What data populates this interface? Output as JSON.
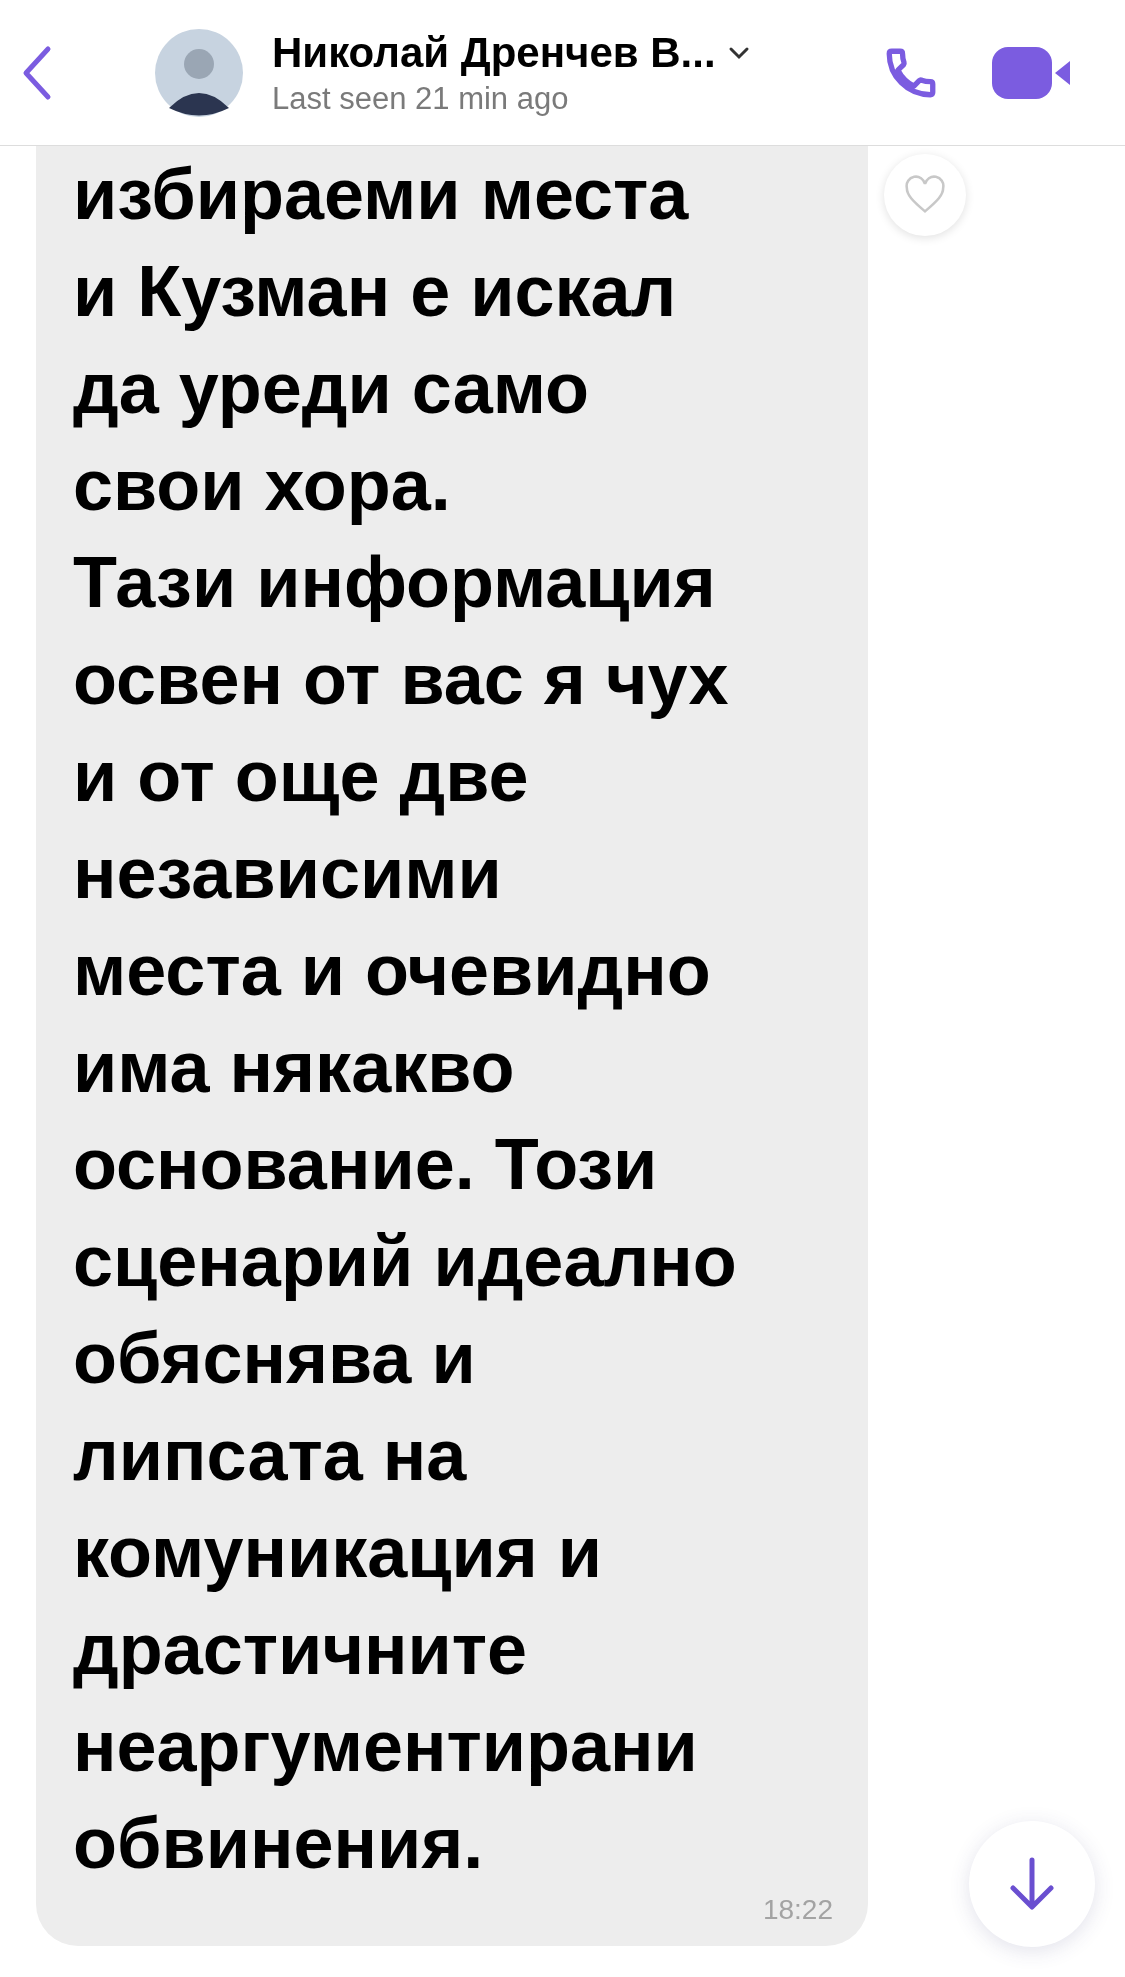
{
  "header": {
    "contact_name": "Николай Дренчев В...",
    "status": "Last seen 21 min ago"
  },
  "message": {
    "text": "избираеми места\nи Кузман е искал\nда уреди само\nсвои хора.\nТази информация\nосвен от вас я чух\nи от още две\nнезависими\nместа и очевидно\nима някакво\nоснование. Този\nсценарий идеално\nобяснява и\nлипсата на\nкомуникация и\nдрастичните\nнеаргументирани\nобвинения.",
    "time": "18:22",
    "liked": false
  }
}
